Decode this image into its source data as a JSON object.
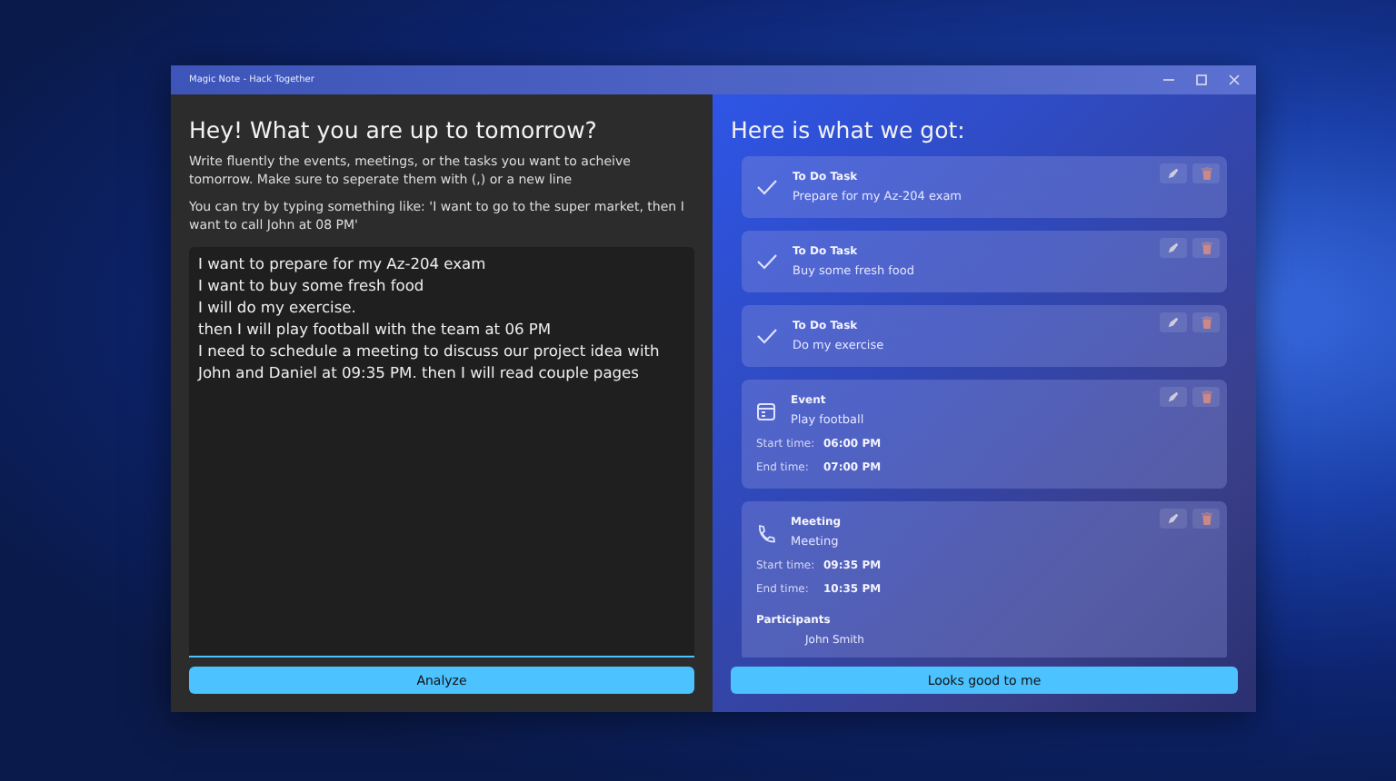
{
  "window": {
    "title": "Magic Note - Hack Together"
  },
  "input_panel": {
    "heading": "Hey! What you are up to tomorrow?",
    "instructions": "Write fluently the events, meetings, or the tasks you want to acheive tomorrow. Make sure to seperate them with (,) or a new line",
    "example": "You can try by typing something like: 'I want to go to the super market, then I want to call John at 08 PM'",
    "text_value": "I want to prepare for my Az-204 exam\nI want to buy some fresh food\nI will do my exercise.\nthen I will play football with the team at 06 PM\nI need to schedule a meeting to discuss our project idea with John and Daniel at 09:35 PM. then I will read couple pages",
    "button": "Analyze"
  },
  "results_panel": {
    "heading": "Here is what we got:",
    "items": [
      {
        "kind": "todo",
        "type_label": "To Do Task",
        "title": "Prepare for my Az-204 exam"
      },
      {
        "kind": "todo",
        "type_label": "To Do Task",
        "title": "Buy some fresh food"
      },
      {
        "kind": "todo",
        "type_label": "To Do Task",
        "title": "Do my exercise"
      },
      {
        "kind": "event",
        "type_label": "Event",
        "title": "Play football",
        "times": [
          {
            "label": "Start time:",
            "value": "06:00 PM"
          },
          {
            "label": "End time:",
            "value": "07:00 PM"
          }
        ]
      },
      {
        "kind": "meeting",
        "type_label": "Meeting",
        "title": "Meeting",
        "times": [
          {
            "label": "Start time:",
            "value": "09:35 PM"
          },
          {
            "label": "End time:",
            "value": "10:35 PM"
          }
        ],
        "participants_label": "Participants",
        "participants": [
          "John Smith"
        ]
      }
    ],
    "button": "Looks good to me"
  }
}
